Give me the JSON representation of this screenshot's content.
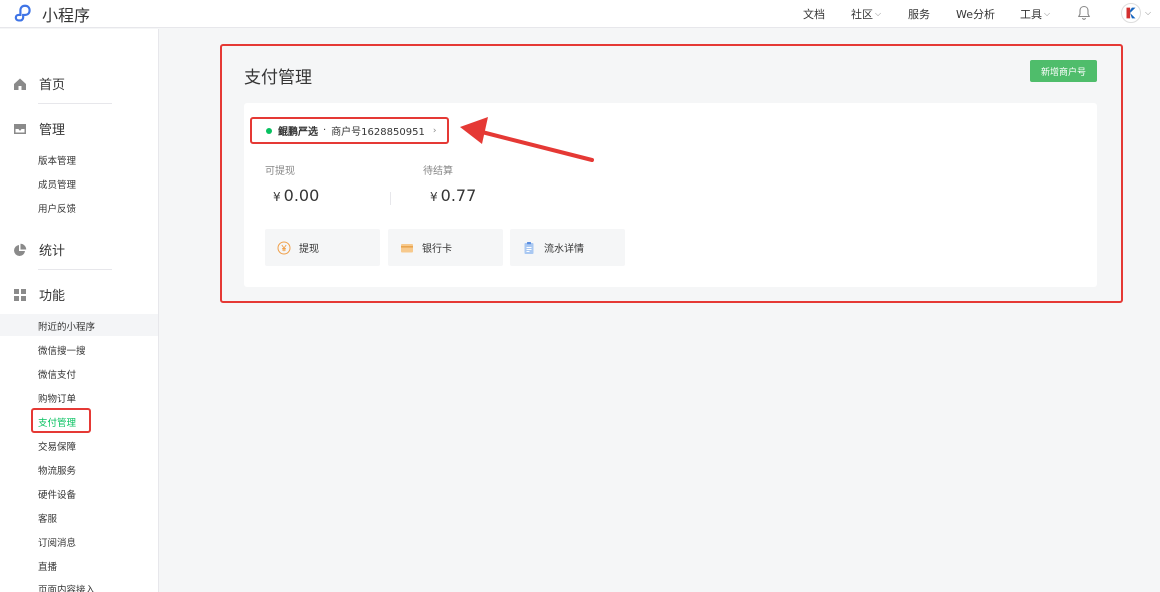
{
  "header": {
    "app_title": "小程序",
    "nav": [
      {
        "label": "文档",
        "has_dropdown": false
      },
      {
        "label": "社区",
        "has_dropdown": true
      },
      {
        "label": "服务",
        "has_dropdown": false
      },
      {
        "label": "We分析",
        "has_dropdown": false
      },
      {
        "label": "工具",
        "has_dropdown": true
      }
    ]
  },
  "sidebar": {
    "sections": [
      {
        "label": "首页",
        "icon": "home-icon"
      },
      {
        "label": "管理",
        "icon": "inbox-icon",
        "items": [
          "版本管理",
          "成员管理",
          "用户反馈"
        ]
      },
      {
        "label": "统计",
        "icon": "pie-chart-icon"
      },
      {
        "label": "功能",
        "icon": "grid-icon",
        "items": [
          "附近的小程序",
          "微信搜一搜",
          "微信支付",
          "购物订单",
          "支付管理",
          "交易保障",
          "物流服务",
          "硬件设备",
          "客服",
          "订阅消息",
          "直播",
          "页面内容接入"
        ]
      }
    ],
    "active_item": "支付管理"
  },
  "main": {
    "title": "支付管理",
    "add_button": "新增商户号",
    "merchant": {
      "name": "鲲鹏严选",
      "separator": "·",
      "id_label": "商户号1628850951"
    },
    "stats": [
      {
        "label": "可提现",
        "currency": "¥",
        "value": "0.00"
      },
      {
        "label": "待结算",
        "currency": "¥",
        "value": "0.77"
      }
    ],
    "actions": [
      {
        "label": "提现",
        "icon": "yen-coin-icon"
      },
      {
        "label": "银行卡",
        "icon": "bank-card-icon"
      },
      {
        "label": "流水详情",
        "icon": "clipboard-icon"
      }
    ]
  },
  "colors": {
    "accent": "#07c160",
    "button": "#4fbd6b",
    "annotation": "#e53935"
  }
}
